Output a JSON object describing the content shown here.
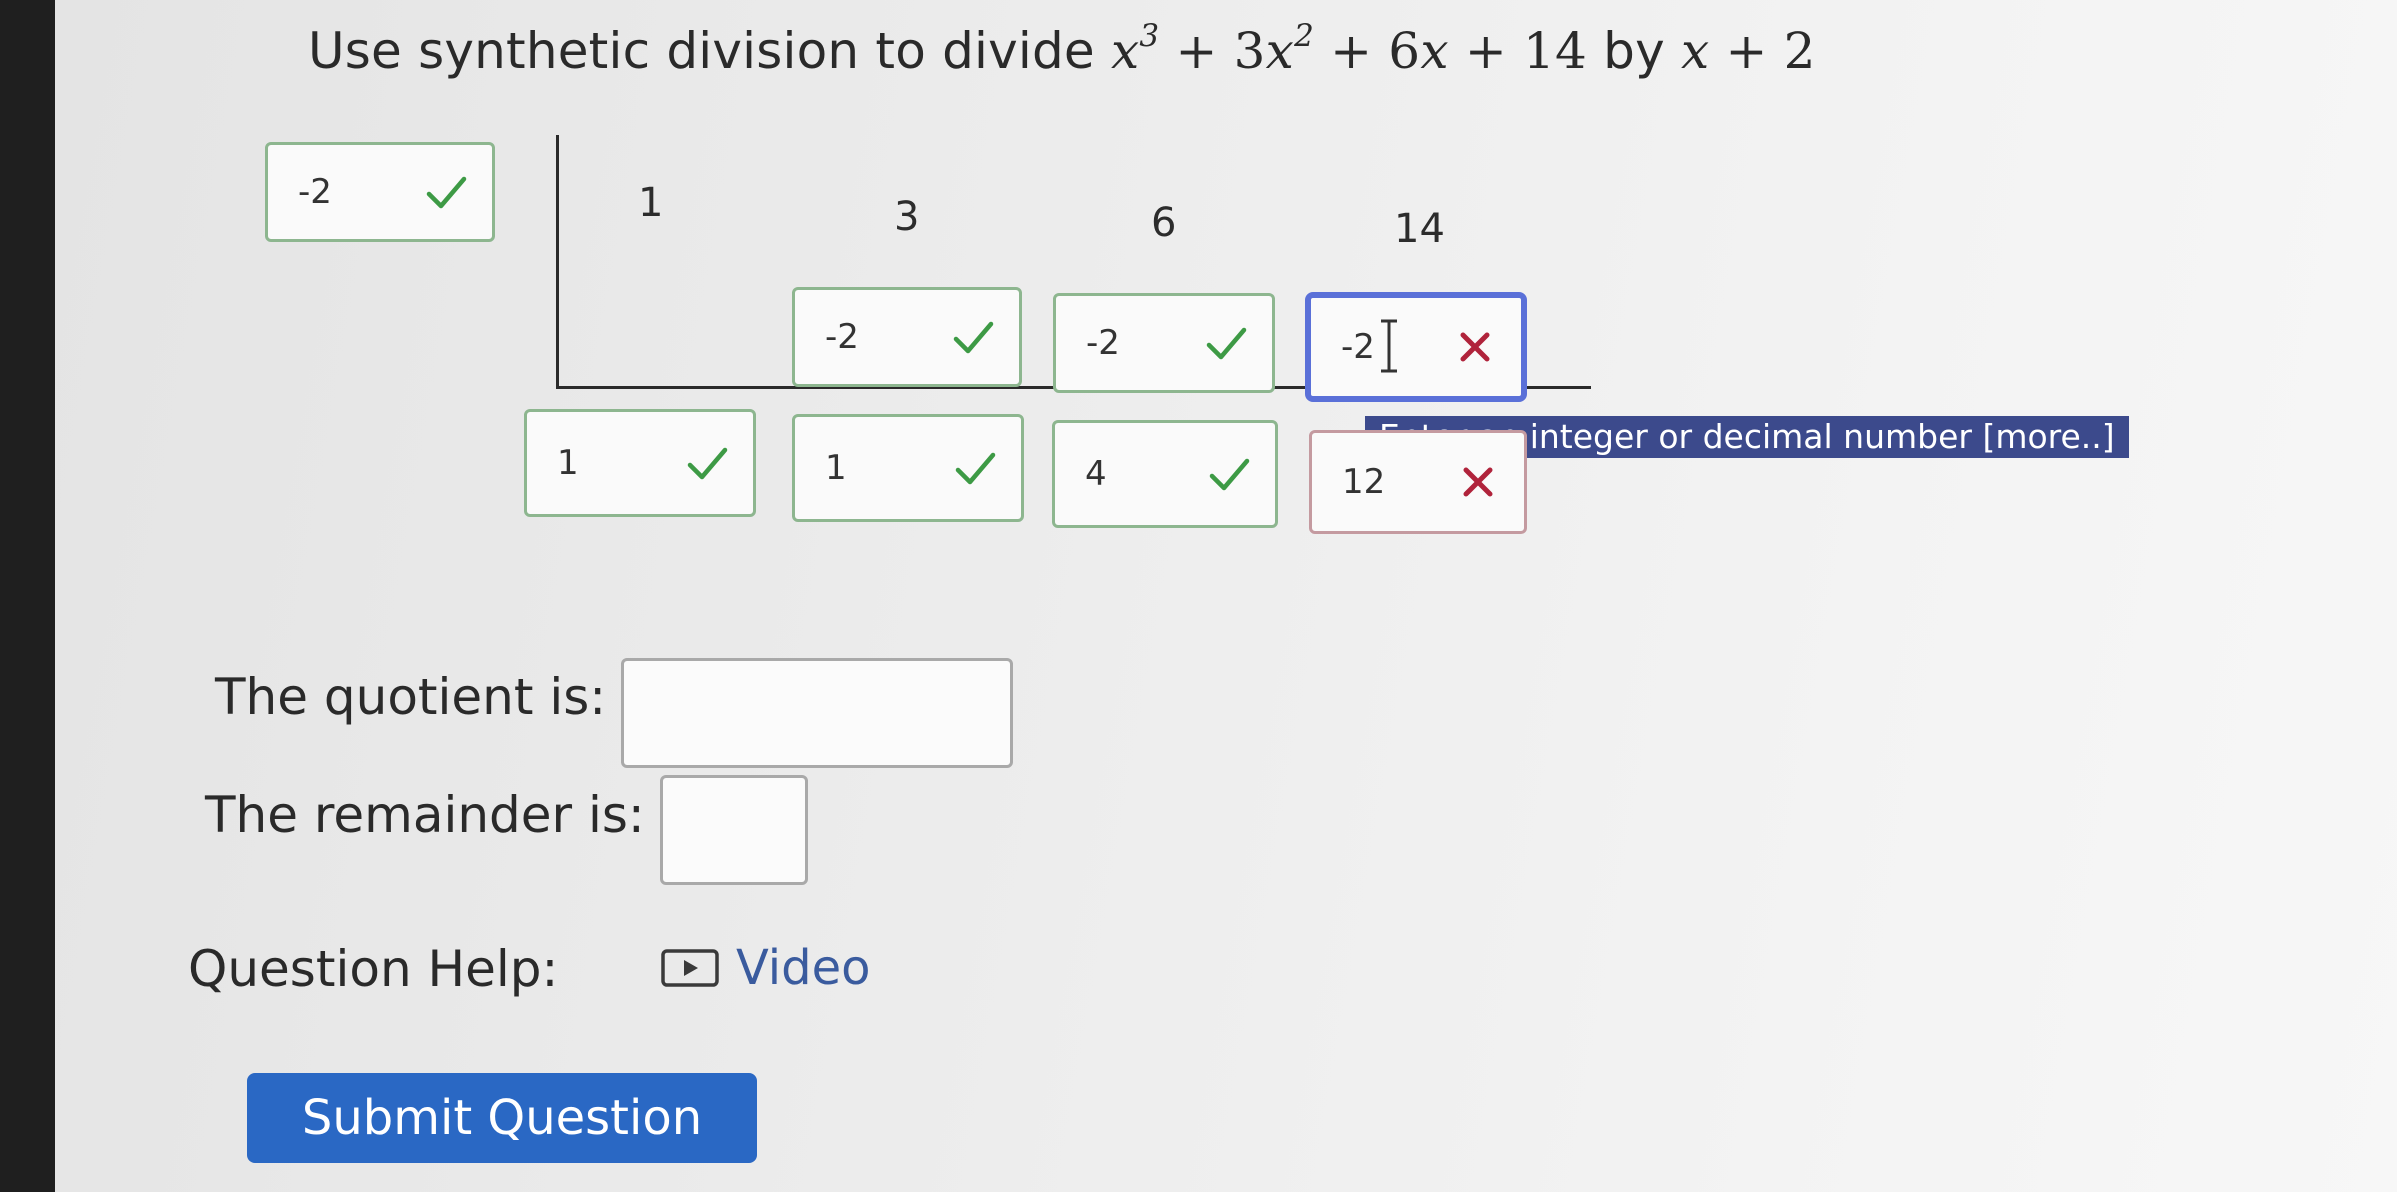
{
  "question": {
    "prefix": "Use synthetic division to divide",
    "by_word": "by",
    "dividend": {
      "t1": "x",
      "p1": "3",
      "t2c": "3",
      "t2": "x",
      "p2": "2",
      "t3c": "6",
      "t3": "x",
      "t4": "14"
    },
    "divisor": {
      "var": "x",
      "const": "2"
    }
  },
  "synthetic": {
    "root_input": {
      "value": "-2",
      "status": "correct"
    },
    "coefficients": [
      "1",
      "3",
      "6",
      "14"
    ],
    "middle_row": [
      {
        "value": "-2",
        "status": "correct"
      },
      {
        "value": "-2",
        "status": "correct"
      },
      {
        "value": "-2",
        "status": "incorrect"
      }
    ],
    "bottom_row": [
      {
        "value": "1",
        "status": "correct"
      },
      {
        "value": "1",
        "status": "correct"
      },
      {
        "value": "4",
        "status": "correct"
      },
      {
        "value": "12",
        "status": "incorrect"
      }
    ],
    "tooltip": "Enter an integer or decimal number [more..]"
  },
  "answers": {
    "quotient_label": "The quotient is:",
    "quotient_value": "",
    "remainder_label": "The remainder is:",
    "remainder_value": ""
  },
  "help": {
    "label": "Question Help:",
    "video_label": "Video"
  },
  "submit_label": "Submit Question",
  "colors": {
    "correct": "#3d9a45",
    "incorrect": "#b0233b",
    "active_border": "#5a70d8",
    "submit_bg": "#2a68c4",
    "link": "#3a5b9e",
    "tooltip_bg": "#3c4a8c"
  }
}
